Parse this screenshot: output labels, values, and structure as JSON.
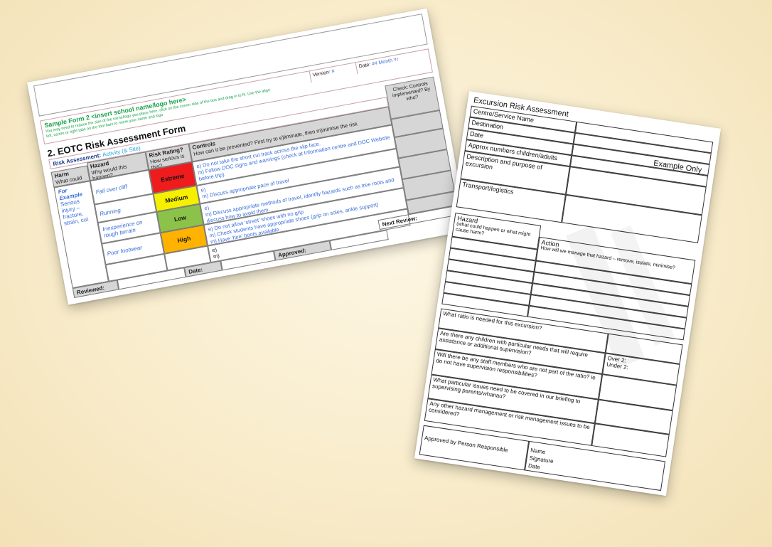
{
  "form1": {
    "sample_title": "Sample Form 2 <insert school name/logo here>",
    "sample_note": "You may need to reduce the size of the name/logo you place here, click on the corner side of the box and drag in to fit. Use the align left, centre or right tabs on the tool bars to move your name and logo",
    "version_label": "Version:",
    "version_value": "#",
    "date_label": "Date:",
    "date_value": "## Month Yr",
    "form_title": "2. EOTC Risk Assessment Form",
    "risk_assessment_label": "Risk Assessment:",
    "risk_assessment_value": "Activity (& Site)",
    "check_header": "Check: Controls implemented? By who?",
    "headers": {
      "harm": "Harm",
      "harm_sub": "What could go wrong?",
      "hazard": "Hazard",
      "hazard_sub": "Why would this happen?",
      "rating": "Risk Rating?",
      "rating_sub": "How serious is this?",
      "controls": "Controls",
      "controls_sub": "How can it be prevented? First try to e)liminate, then m)inimise the risk"
    },
    "harm_example_label": "For Example",
    "harm_example_text": "Serious injury – fracture, strain, cut",
    "rows": [
      {
        "hazard": "Fall over cliff",
        "rating": "Extreme",
        "color": "#ee1c1c",
        "controls": [
          "e) Do not take the short cut track across the slip face.",
          "m) Follow DOC signs and warnings (check at Information centre and DOC Website before trip)"
        ]
      },
      {
        "hazard": "Running",
        "rating": "Medium",
        "color": "#f6f000",
        "controls": [
          "e)",
          "m) Discuss appropriate pace of travel"
        ]
      },
      {
        "hazard": "Inexperience on rough terrain",
        "rating": "Low",
        "color": "#8bc34a",
        "controls": [
          "e)",
          "m) Discuss appropriate methods of travel, identify hazards such as tree roots and discuss how to avoid them."
        ]
      },
      {
        "hazard": "Poor footwear",
        "rating": "High",
        "color": "#ffb300",
        "controls": [
          "e) Do not allow 'street' shoes with no grip",
          "m) Check students have appropriate shoes (grip on soles, ankle support)",
          "m) Have 'hire' boots available"
        ]
      },
      {
        "hazard": "",
        "rating": "",
        "color": "#ffffff",
        "controls": [
          "e)",
          "m)"
        ]
      }
    ],
    "next_review_label": "Next Review:",
    "reviewed_label": "Reviewed:",
    "date_bottom_label": "Date:",
    "approved_label": "Approved:"
  },
  "form2": {
    "title": "Excursion Risk Assessment",
    "example_only": "Example Only",
    "fields": [
      "Centre/Service Name",
      "Destination",
      "Date",
      "Approx numbers children/adults",
      "Description and purpose of excursion",
      "Transport/logistics"
    ],
    "hazard_label": "Hazard",
    "hazard_sub": "(what could happen or what might cause harm?",
    "action_label": "Action",
    "action_sub": "How will we manage that hazard – remove, isolate, minimise?",
    "questions": [
      "What ratio is needed for this excursion?",
      "Are there any children with particular needs that will require assistance or additional supervision?",
      "Will there be any staff members who are not part of the ratio? ie do not have supervision responsibilities?",
      "What particular issues need to be covered in our briefing to supervising parents/whanau?",
      "Any other hazard management or risk management issues to be considered?"
    ],
    "over2": "Over 2:",
    "under2": "Under 2:",
    "approved_by": "Approved by Person Responsible",
    "name": "Name",
    "signature": "Signature",
    "date": "Date"
  }
}
